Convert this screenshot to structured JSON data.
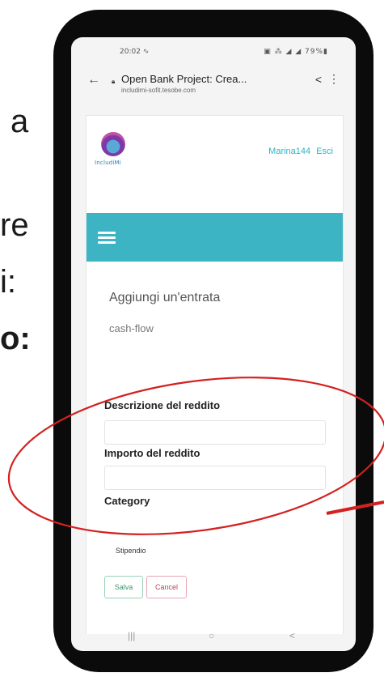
{
  "slide": {
    "fragments": [
      "a",
      "re",
      "i:",
      "o:"
    ]
  },
  "status_bar": {
    "time": "20:02 ∿",
    "icons": "▣ ⁂ ◢ ◢ 79%▮"
  },
  "browser": {
    "tab_title": "Open Bank Project: Crea...",
    "domain": "includimi-sofit.tesobe.com"
  },
  "site": {
    "logo_text": "IncludiMi",
    "username": "Marina144",
    "logout_label": "Esci"
  },
  "form": {
    "title": "Aggiungi un'entrata",
    "subtitle": "cash-flow",
    "fields": [
      {
        "label": "Descrizione del reddito",
        "value": ""
      },
      {
        "label": "Importo del reddito",
        "value": ""
      }
    ],
    "category_label": "Category",
    "category_value": "Stipendio",
    "save_label": "Salva",
    "cancel_label": "Cancel"
  },
  "system_nav": {
    "recents": "|||",
    "home": "○",
    "back": "<"
  },
  "colors": {
    "navbar": "#3cb4c4",
    "link": "#2ab4c4",
    "annotation": "#d42020"
  }
}
